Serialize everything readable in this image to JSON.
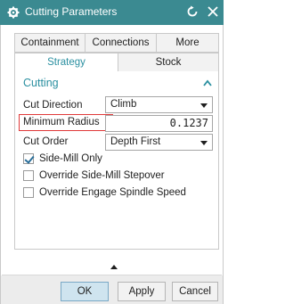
{
  "window": {
    "title": "Cutting Parameters",
    "title_bar_color": "#3b8a91"
  },
  "tabs_row1": [
    "Containment",
    "Connections",
    "More"
  ],
  "tabs_row2": [
    "Strategy",
    "Stock"
  ],
  "active_tab": "Strategy",
  "section": {
    "title": "Cutting",
    "collapse_icon": "chevron-up-icon"
  },
  "fields": {
    "cut_direction": {
      "label": "Cut Direction",
      "value": "Climb"
    },
    "minimum_radius": {
      "label": "Minimum Radius",
      "value": "0.1237"
    },
    "cut_order": {
      "label": "Cut Order",
      "value": "Depth First"
    }
  },
  "checkboxes": [
    {
      "label": "Side-Mill Only",
      "checked": true
    },
    {
      "label": "Override Side-Mill Stepover",
      "checked": false
    },
    {
      "label": "Override Engage Spindle Speed",
      "checked": false
    }
  ],
  "buttons": {
    "ok": "OK",
    "apply": "Apply",
    "cancel": "Cancel"
  },
  "accent_color": "#2a8fa0",
  "highlight_color": "#e03a3a"
}
